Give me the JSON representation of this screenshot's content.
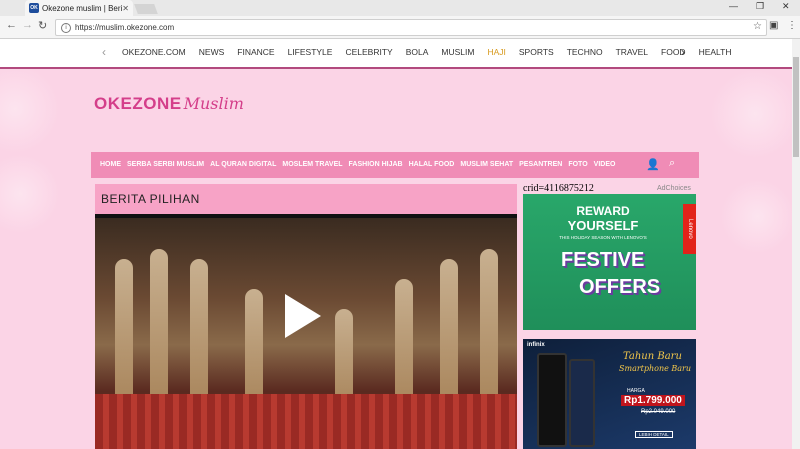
{
  "browser": {
    "tab_title": "Okezone muslim | Berita",
    "tab_favicon_text": "OK",
    "url": "https://muslim.okezone.com"
  },
  "topnav": {
    "items": [
      "OKEZONE.COM",
      "NEWS",
      "FINANCE",
      "LIFESTYLE",
      "CELEBRITY",
      "BOLA",
      "MUSLIM",
      "HAJI",
      "SPORTS",
      "TECHNO",
      "TRAVEL",
      "FOOD",
      "HEALTH"
    ],
    "active_color": "#d79a1e"
  },
  "logo": {
    "part1": "OKEZONE",
    "part2": "Muslim"
  },
  "mainnav": {
    "items": [
      "HOME",
      "SERBA SERBI MUSLIM",
      "AL QURAN DIGITAL",
      "MOSLEM TRAVEL",
      "FASHION HIJAB",
      "HALAL FOOD",
      "MUSLIM SEHAT",
      "PESANTREN",
      "FOTO",
      "VIDEO"
    ]
  },
  "section": {
    "title": "BERITA PILIHAN"
  },
  "sidebar": {
    "crid": "crid=4116875212",
    "adchoices": "AdChoices",
    "ad1": {
      "line1": "REWARD",
      "line2": "YOURSELF",
      "line3": "THIS HOLIDAY SEASON WITH LENOVO'S",
      "big1": "FESTIVE",
      "big2": "OFFERS",
      "brand": "Lenovo"
    },
    "ad2": {
      "brand": "infinix",
      "headline": "Tahun Baru",
      "subline": "Smartphone Baru",
      "price_label": "HARGA",
      "price": "Rp1.799.000",
      "old_price": "Rp2.049.000",
      "cta": "LEBIH DETAIL"
    }
  },
  "colors": {
    "brand_pink": "#d43e8a",
    "nav_pink": "#f08cb6",
    "bg_pink": "#fbd4e6",
    "accent_border": "#b24a7e"
  }
}
